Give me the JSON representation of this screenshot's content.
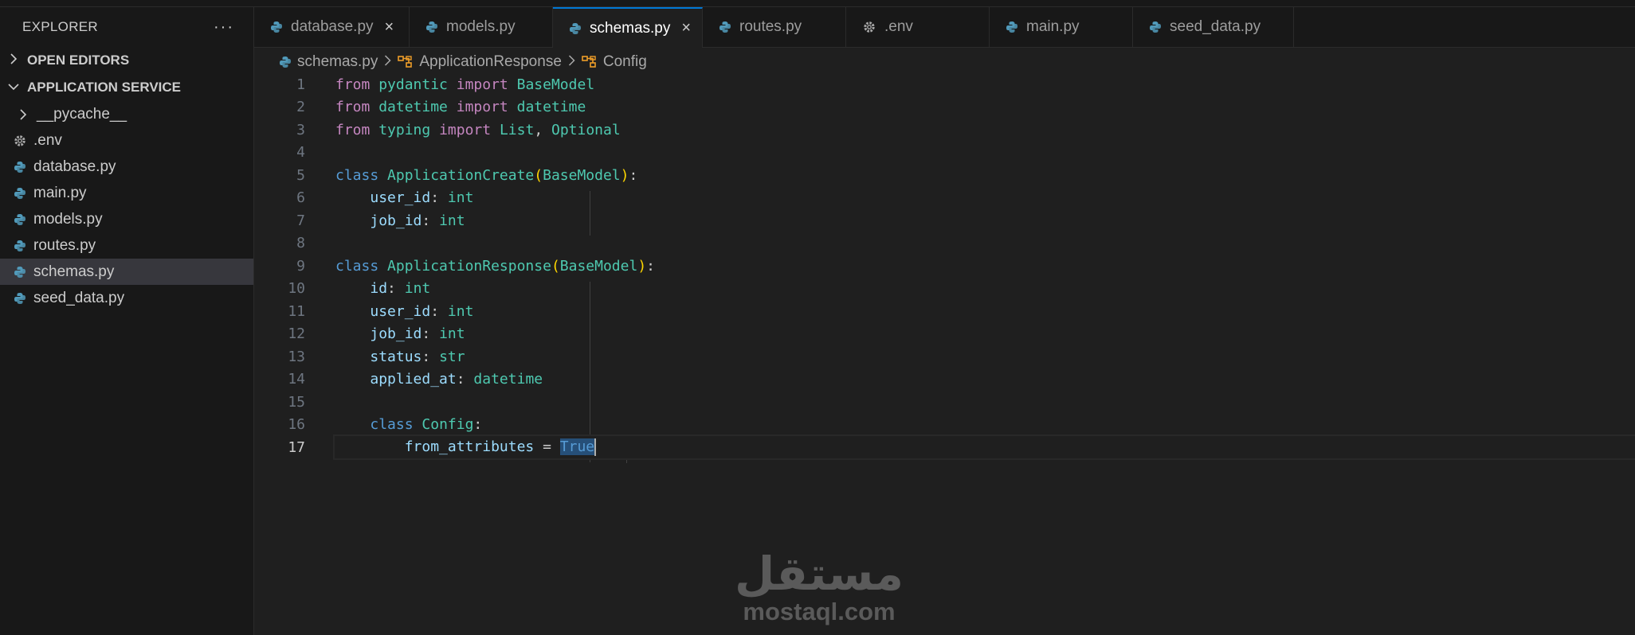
{
  "explorer": {
    "title": "EXPLORER",
    "more_icon": "ellipsis-icon",
    "open_editors_label": "OPEN EDITORS",
    "project_label": "APPLICATION SERVICE",
    "items": [
      {
        "label": "__pycache__",
        "type": "folder"
      },
      {
        "label": ".env",
        "type": "env"
      },
      {
        "label": "database.py",
        "type": "python"
      },
      {
        "label": "main.py",
        "type": "python"
      },
      {
        "label": "models.py",
        "type": "python"
      },
      {
        "label": "routes.py",
        "type": "python"
      },
      {
        "label": "schemas.py",
        "type": "python",
        "selected": true
      },
      {
        "label": "seed_data.py",
        "type": "python"
      }
    ]
  },
  "tabs": [
    {
      "label": "database.py",
      "icon": "python-icon",
      "close": "×"
    },
    {
      "label": "models.py",
      "icon": "python-icon"
    },
    {
      "label": "schemas.py",
      "icon": "python-icon",
      "active": true,
      "close": "×"
    },
    {
      "label": "routes.py",
      "icon": "python-icon"
    },
    {
      "label": ".env",
      "icon": "gear-icon"
    },
    {
      "label": "main.py",
      "icon": "python-icon"
    },
    {
      "label": "seed_data.py",
      "icon": "python-icon"
    }
  ],
  "breadcrumb": {
    "file": "schemas.py",
    "class": "ApplicationResponse",
    "inner": "Config"
  },
  "editor": {
    "current_line": 17,
    "line_numbers": [
      "1",
      "2",
      "3",
      "4",
      "5",
      "6",
      "7",
      "8",
      "9",
      "10",
      "11",
      "12",
      "13",
      "14",
      "15",
      "16",
      "17"
    ]
  },
  "colors": {
    "keyword": "#c586c0",
    "class_keyword": "#569cd6",
    "type": "#4ec9b0",
    "variable": "#9cdcfe",
    "accent": "#0078d4",
    "python_icon": "#519aba"
  },
  "watermark": {
    "arabic": "مستقل",
    "latin": "mostaql.com"
  }
}
